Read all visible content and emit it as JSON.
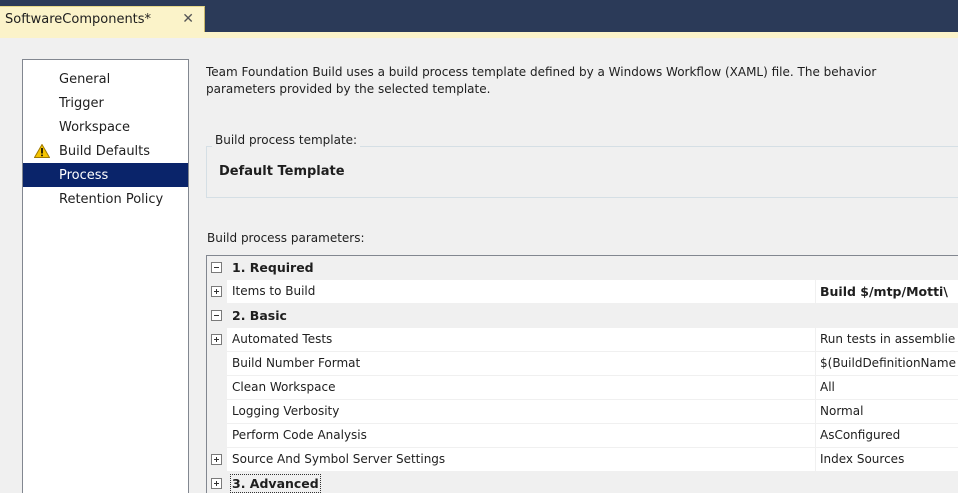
{
  "tab": {
    "title": "SoftwareComponents*",
    "close_glyph": "✕"
  },
  "nav": {
    "items": [
      {
        "label": "General"
      },
      {
        "label": "Trigger"
      },
      {
        "label": "Workspace"
      },
      {
        "label": "Build Defaults",
        "icon": "warning-icon"
      },
      {
        "label": "Process",
        "selected": true
      },
      {
        "label": "Retention Policy"
      }
    ]
  },
  "description": {
    "line1": "Team Foundation Build uses a build process template defined by a Windows Workflow (XAML) file. The behavior",
    "line2": "parameters provided by the selected template."
  },
  "template_group": {
    "legend": "Build process template:",
    "selected_template": "Default Template"
  },
  "parameters": {
    "label": "Build process parameters:",
    "rows": [
      {
        "type": "category",
        "expander": "minus",
        "name": "1. Required",
        "value": ""
      },
      {
        "type": "prop",
        "expander": "plus",
        "name": "Items to Build",
        "value": "Build $/mtp/Motti\\",
        "value_bold": true
      },
      {
        "type": "category",
        "expander": "minus",
        "name": "2. Basic",
        "value": ""
      },
      {
        "type": "prop",
        "expander": "plus",
        "name": "Automated Tests",
        "value": "Run tests in assemblie"
      },
      {
        "type": "prop",
        "expander": "",
        "name": "Build Number Format",
        "value": "$(BuildDefinitionName"
      },
      {
        "type": "prop",
        "expander": "",
        "name": "Clean Workspace",
        "value": "All"
      },
      {
        "type": "prop",
        "expander": "",
        "name": "Logging Verbosity",
        "value": "Normal"
      },
      {
        "type": "prop",
        "expander": "",
        "name": "Perform Code Analysis",
        "value": "AsConfigured"
      },
      {
        "type": "prop",
        "expander": "plus",
        "name": "Source And Symbol Server Settings",
        "value": "Index Sources"
      },
      {
        "type": "category",
        "expander": "plus",
        "name": "3. Advanced",
        "value": "",
        "focused": true
      }
    ]
  },
  "colors": {
    "tabstrip": "#2b3a58",
    "active_tab": "#fbf3c9",
    "nav_selected": "#0a246a",
    "warning": "#f5c400"
  }
}
